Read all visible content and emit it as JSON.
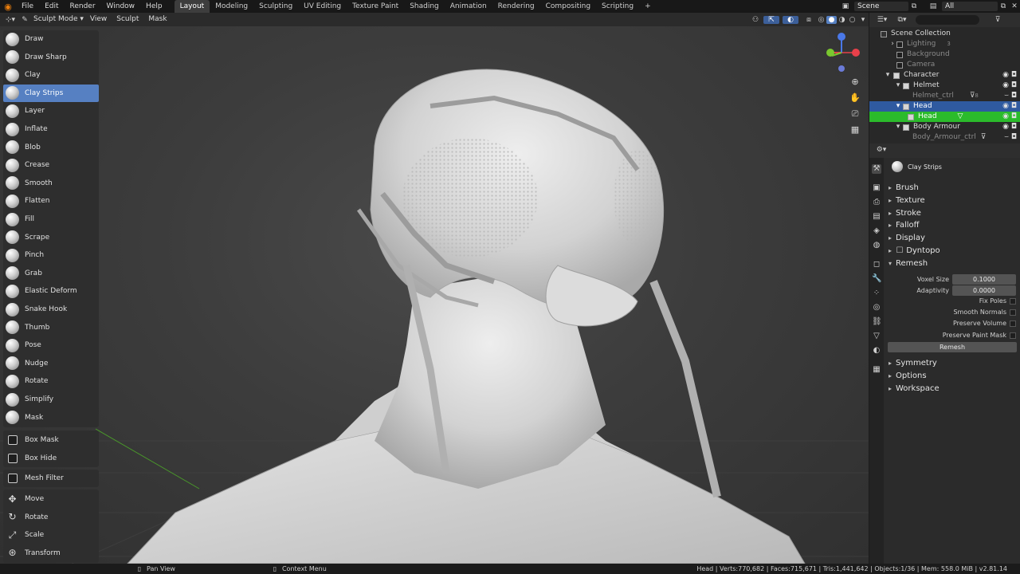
{
  "topbar": {
    "menus": [
      "File",
      "Edit",
      "Render",
      "Window",
      "Help"
    ],
    "workspaces": [
      "Layout",
      "Modeling",
      "Sculpting",
      "UV Editing",
      "Texture Paint",
      "Shading",
      "Animation",
      "Rendering",
      "Compositing",
      "Scripting"
    ],
    "active_workspace": "Layout",
    "add_tab": "+",
    "scene": "Scene",
    "view_layer": "All"
  },
  "header": {
    "mode": "Sculpt Mode",
    "menus": [
      "View",
      "Sculpt",
      "Mask"
    ]
  },
  "toolbar": {
    "brushes": [
      "Draw",
      "Draw Sharp",
      "Clay",
      "Clay Strips",
      "Layer",
      "Inflate",
      "Blob",
      "Crease",
      "Smooth",
      "Flatten",
      "Fill",
      "Scrape",
      "Pinch",
      "Grab",
      "Elastic Deform",
      "Snake Hook",
      "Thumb",
      "Pose",
      "Nudge",
      "Rotate",
      "Simplify",
      "Mask"
    ],
    "active_brush": "Clay Strips",
    "mask_tools": [
      "Box Mask",
      "Box Hide"
    ],
    "filter_tools": [
      "Mesh Filter"
    ],
    "transform_tools": [
      "Move",
      "Rotate",
      "Scale",
      "Transform"
    ]
  },
  "gizmo": {
    "axes": [
      "X",
      "Y",
      "Z"
    ],
    "colors": {
      "x": "#e8404a",
      "y": "#7ac72f",
      "z": "#4a78e8"
    }
  },
  "outliner": {
    "items": [
      {
        "label": "Scene Collection",
        "depth": 0,
        "state": "normal"
      },
      {
        "label": "Lighting",
        "depth": 1,
        "state": "dim",
        "badge": "3"
      },
      {
        "label": "Background",
        "depth": 1,
        "state": "dim"
      },
      {
        "label": "Camera",
        "depth": 1,
        "state": "dim"
      },
      {
        "label": "Character",
        "depth": 1,
        "state": "normal"
      },
      {
        "label": "Helmet",
        "depth": 2,
        "state": "normal"
      },
      {
        "label": "Helmet_ctrl",
        "depth": 3,
        "state": "dim",
        "badge": "8"
      },
      {
        "label": "Head",
        "depth": 2,
        "state": "selected"
      },
      {
        "label": "Head",
        "depth": 3,
        "state": "active"
      },
      {
        "label": "Body Armour",
        "depth": 2,
        "state": "normal"
      },
      {
        "label": "Body_Armour_ctrl",
        "depth": 3,
        "state": "dim"
      }
    ]
  },
  "properties": {
    "brush_name": "Clay Strips",
    "panels_top": [
      "Brush",
      "Texture",
      "Stroke",
      "Falloff",
      "Display",
      "Dyntopo",
      "Remesh"
    ],
    "remesh": {
      "voxel_size_label": "Voxel Size",
      "voxel_size": "0.1000",
      "adaptivity_label": "Adaptivity",
      "adaptivity": "0.0000",
      "options": [
        "Fix Poles",
        "Smooth Normals",
        "Preserve Volume",
        "Preserve Paint Mask"
      ],
      "button": "Remesh"
    },
    "panels_bottom": [
      "Symmetry",
      "Options",
      "Workspace"
    ]
  },
  "statusbar": {
    "pan": "Pan View",
    "context": "Context Menu",
    "stats": "Head | Verts:770,682 | Faces:715,671 | Tris:1,441,642 | Objects:1/36 | Mem: 558.0 MiB | v2.81.14"
  }
}
